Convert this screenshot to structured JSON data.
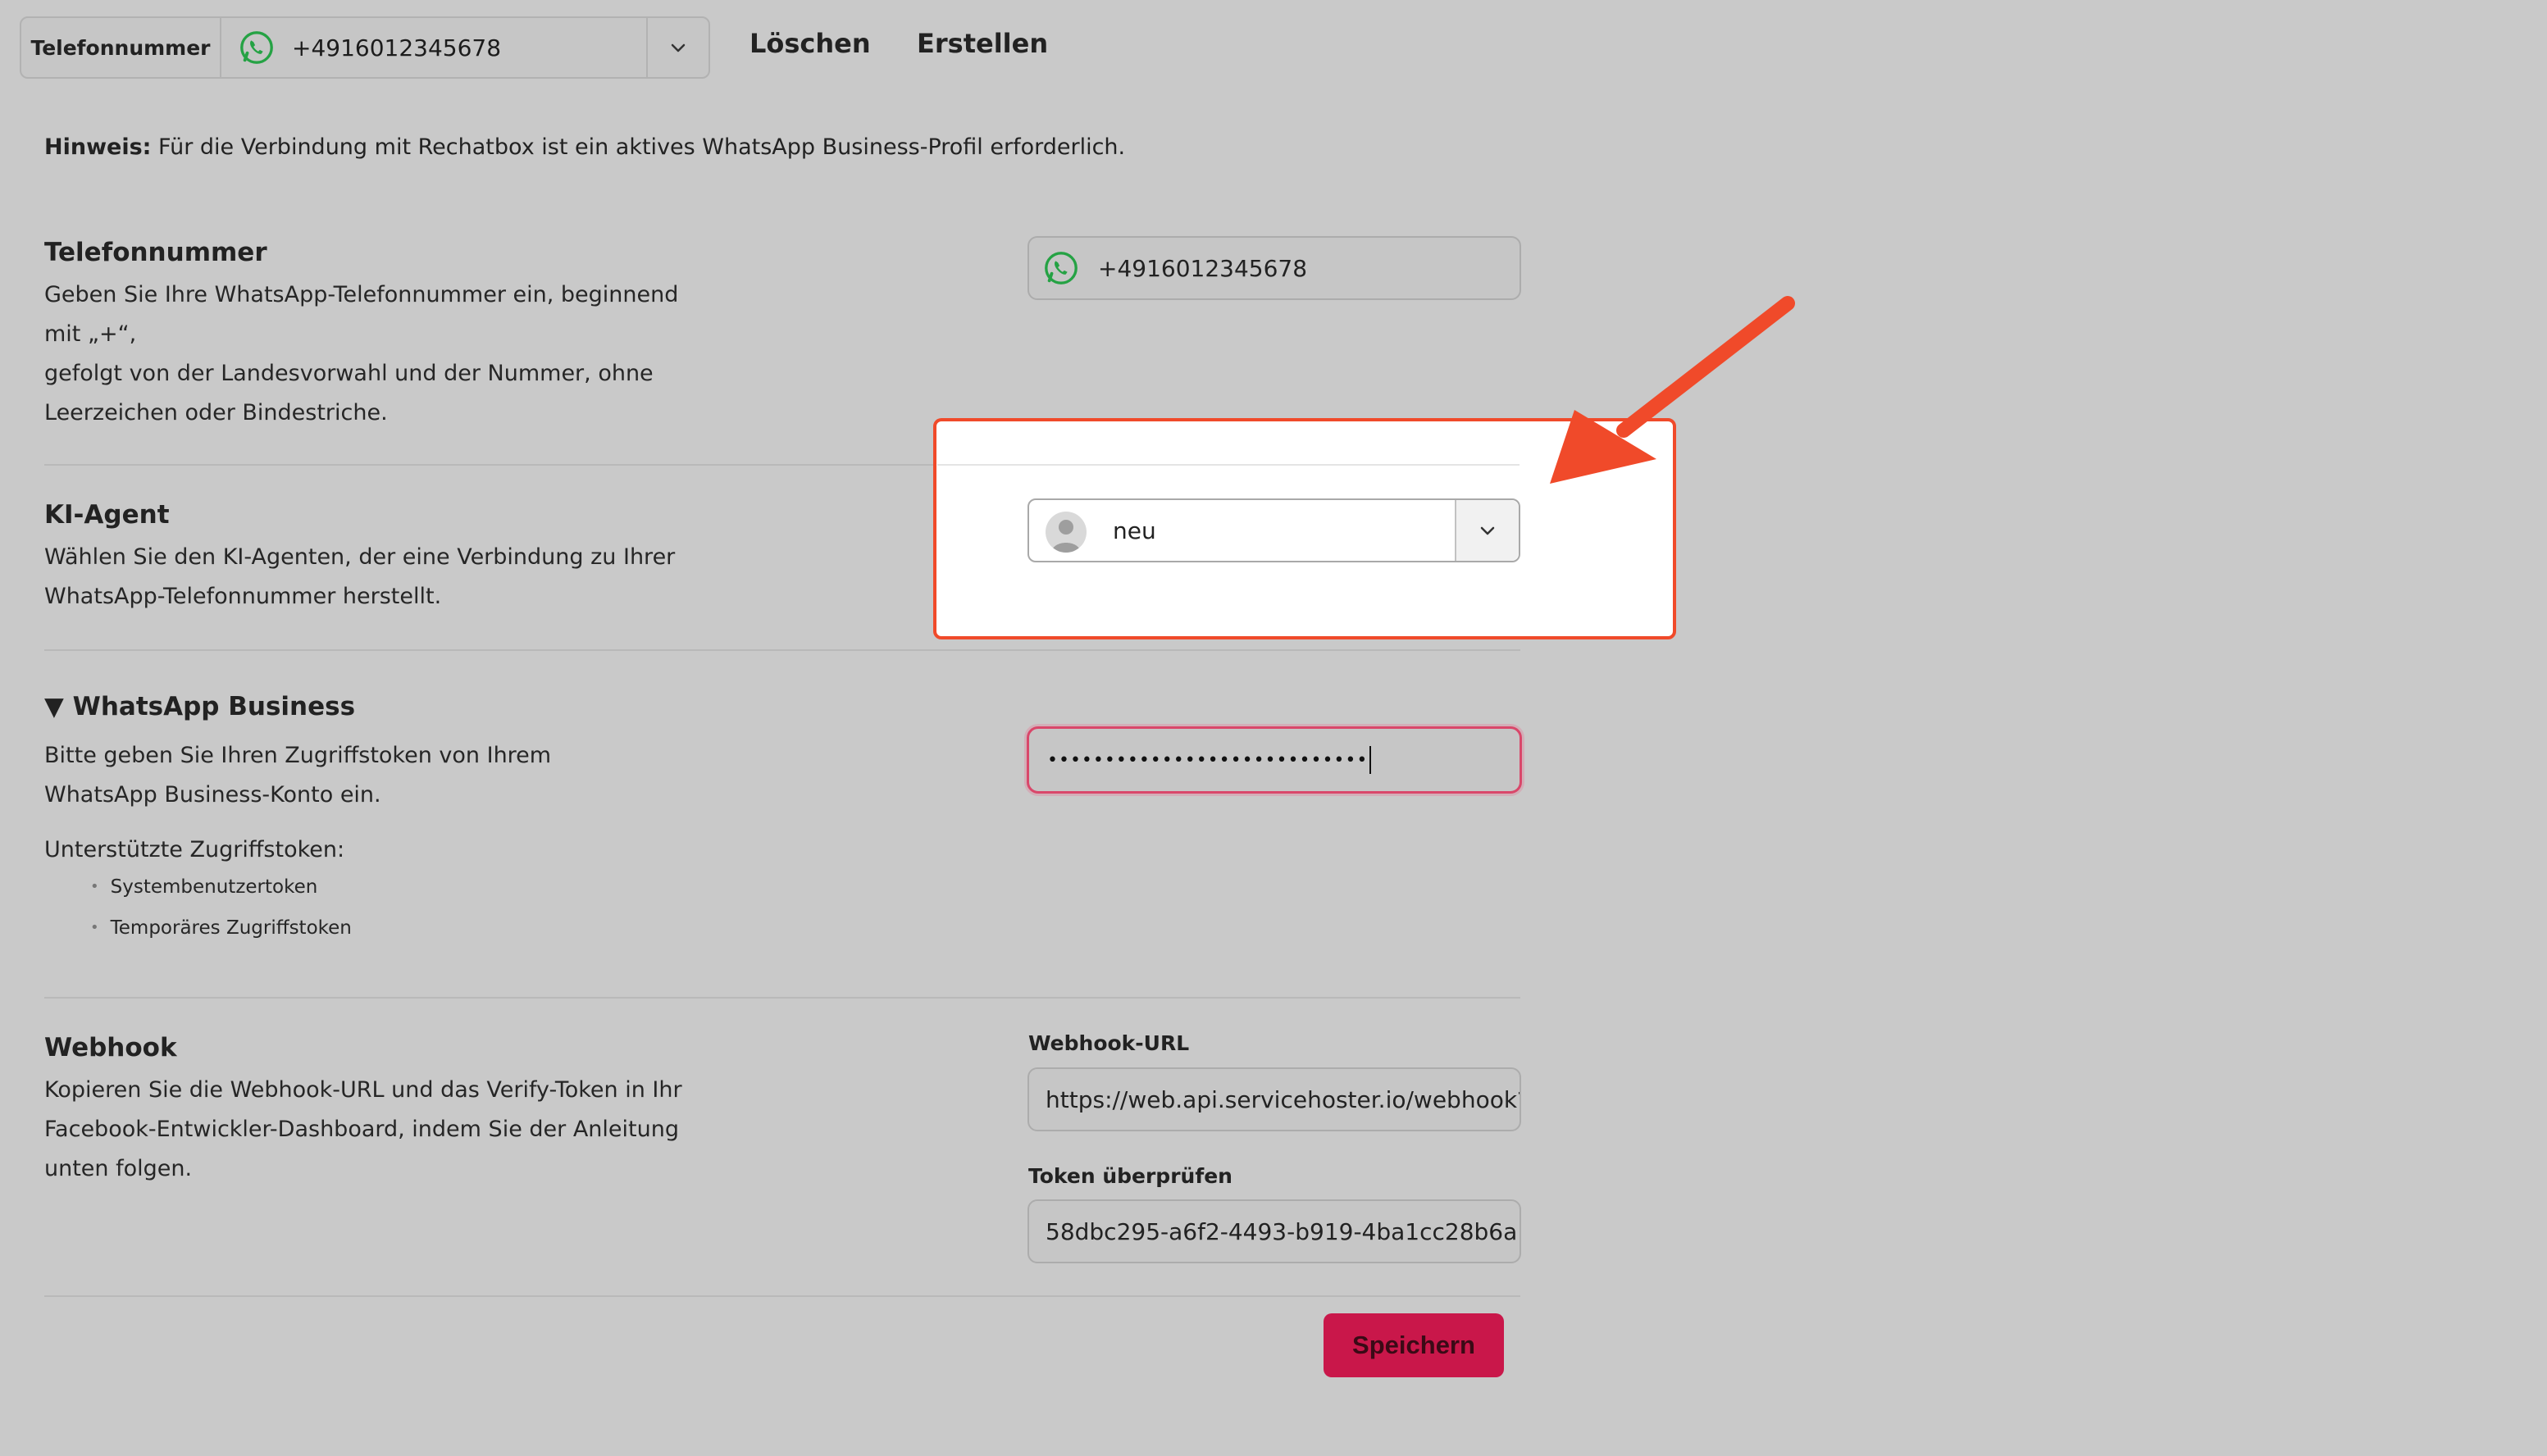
{
  "topbar": {
    "phone_label": "Telefonnummer",
    "phone_value": "+4916012345678",
    "delete_label": "Löschen",
    "create_label": "Erstellen"
  },
  "hint": {
    "prefix": "Hinweis:",
    "text": " Für die Verbindung mit Rechatbox ist ein aktives WhatsApp Business-Profil erforderlich."
  },
  "phone_section": {
    "title": "Telefonnummer",
    "desc_lines": [
      "Geben Sie Ihre WhatsApp-Telefonnummer ein, beginnend",
      "mit „+“,",
      "gefolgt von der Landesvorwahl und der Nummer, ohne",
      "Leerzeichen oder Bindestriche."
    ],
    "value": "+4916012345678"
  },
  "agent_section": {
    "title": "KI-Agent",
    "desc_lines": [
      "Wählen Sie den KI-Agenten, der eine Verbindung zu Ihrer",
      "WhatsApp-Telefonnummer herstellt."
    ],
    "selected": "neu"
  },
  "business_section": {
    "title": "WhatsApp Business",
    "toggle_glyph": "▼",
    "desc_lines": [
      "Bitte geben Sie Ihren Zugriffstoken von Ihrem",
      "WhatsApp Business-Konto ein."
    ],
    "supported_label": "Unterstützte Zugriffstoken:",
    "supported_items": [
      "Systembenutzertoken",
      "Temporäres Zugriffstoken"
    ],
    "token_masked": "••••••••••••••••••••••••••••"
  },
  "webhook_section": {
    "title": "Webhook",
    "desc_lines": [
      "Kopieren Sie die Webhook-URL und das Verify-Token in Ihr",
      "Facebook-Entwickler-Dashboard, indem Sie der Anleitung",
      "unten folgen."
    ],
    "url_label": "Webhook-URL",
    "url_value": "https://web.api.servicehoster.io/webhook?",
    "token_label": "Token überprüfen",
    "token_value": "58dbc295-a6f2-4493-b919-4ba1cc28b6a"
  },
  "save_label": "Speichern",
  "colors": {
    "accent": "#c9174a",
    "highlight": "#f04a2a",
    "whatsapp": "#25a244"
  },
  "icons": [
    "whatsapp-icon",
    "chevron-down-icon",
    "avatar-icon",
    "arrow-annotation"
  ]
}
